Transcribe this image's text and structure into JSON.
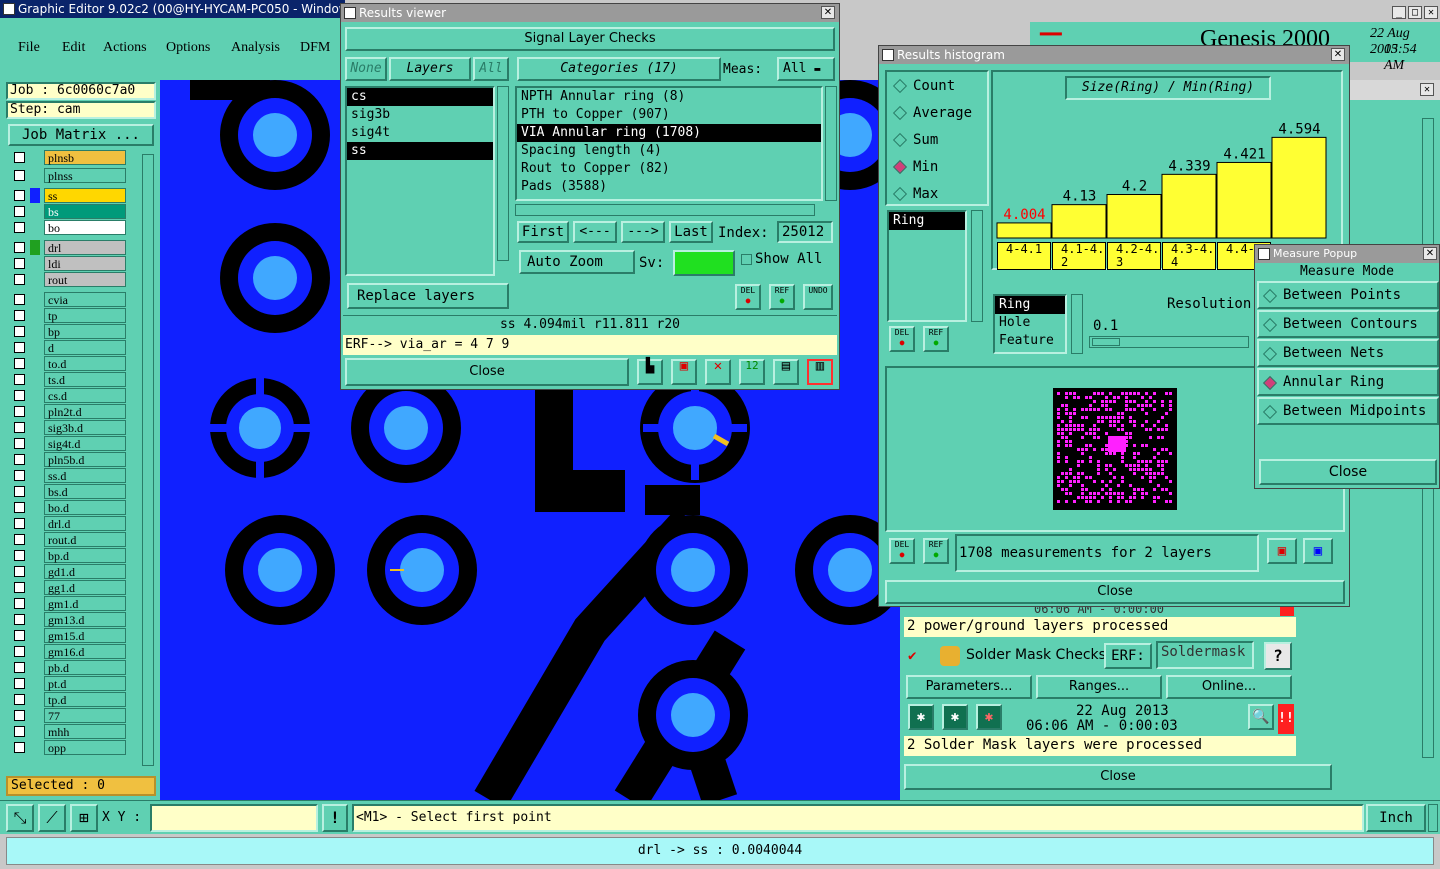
{
  "main_window": {
    "title": "Graphic Editor 9.02c2 (00@HY-HYCAM-PC050 - Windows,"
  },
  "menu": [
    "File",
    "Edit",
    "Actions",
    "Options",
    "Analysis",
    "DFM"
  ],
  "job": {
    "job_label": "Job : 6c0060c7a0",
    "step_label": "Step: cam",
    "matrix_button": "Job Matrix ..."
  },
  "layers": [
    {
      "name": "plnsb",
      "color": "#f0c040"
    },
    {
      "name": "plnss",
      "color": "#5fd0b2"
    },
    {
      "name": "ss",
      "color": "#ffd700",
      "swatch": "#1020ff"
    },
    {
      "name": "bs",
      "color": "#009a7a"
    },
    {
      "name": "bo",
      "color": "#ffffff"
    },
    {
      "name": "drl",
      "color": "#c0c0c0",
      "swatch": "#20a020"
    },
    {
      "name": "ldi",
      "color": "#c0c0c0"
    },
    {
      "name": "rout",
      "color": "#c0c0c0"
    },
    {
      "name": "cvia"
    },
    {
      "name": "tp"
    },
    {
      "name": "bp"
    },
    {
      "name": "d"
    },
    {
      "name": "to.d"
    },
    {
      "name": "ts.d"
    },
    {
      "name": "cs.d"
    },
    {
      "name": "pln2t.d"
    },
    {
      "name": "sig3b.d"
    },
    {
      "name": "sig4t.d"
    },
    {
      "name": "pln5b.d"
    },
    {
      "name": "ss.d"
    },
    {
      "name": "bs.d"
    },
    {
      "name": "bo.d"
    },
    {
      "name": "drl.d"
    },
    {
      "name": "rout.d"
    },
    {
      "name": "bp.d"
    },
    {
      "name": "gd1.d"
    },
    {
      "name": "gg1.d"
    },
    {
      "name": "gm1.d"
    },
    {
      "name": "gm13.d"
    },
    {
      "name": "gm15.d"
    },
    {
      "name": "gm16.d"
    },
    {
      "name": "pb.d"
    },
    {
      "name": "pt.d"
    },
    {
      "name": "tp.d"
    },
    {
      "name": "77"
    },
    {
      "name": "mhh"
    },
    {
      "name": "opp"
    }
  ],
  "selected_label": "Selected : 0",
  "results_viewer": {
    "title": "Results viewer",
    "header": "Signal Layer Checks",
    "none_btn": "None",
    "layers_btn": "Layers",
    "all_btn": "All",
    "categories_btn": "Categories (17)",
    "meas_label": "Meas:",
    "meas_value": "All",
    "layer_list": [
      "cs",
      "sig3b",
      "sig4t",
      "ss"
    ],
    "category_list": [
      "NPTH Annular ring (8)",
      "PTH to Copper (907)",
      "VIA Annular ring (1708)",
      "Spacing length (4)",
      "Rout to Copper (82)",
      "Pads (3588)"
    ],
    "first": "First",
    "prev": "<---",
    "next": "--->",
    "last": "Last",
    "index_label": "Index:",
    "index_value": "25012",
    "auto_zoom": "Auto Zoom",
    "sv_label": "Sv:",
    "show_all": "Show All",
    "replace_layers": "Replace layers",
    "del": "DEL",
    "ref": "REF",
    "undo": "UNDO",
    "measure_info": "ss 4.094mil   r11.811   r20",
    "erf_line": "ERF--> via_ar = 4 7 9",
    "close": "Close"
  },
  "histogram": {
    "title": "Results histogram",
    "modes": [
      "Count",
      "Average",
      "Sum",
      "Min",
      "Max"
    ],
    "selected_mode": "Min",
    "chart_title": "Size(Ring) / Min(Ring)",
    "ring_list": [
      "Ring"
    ],
    "list2": [
      "Ring",
      "Hole",
      "Feature"
    ],
    "resolution_label": "Resolution",
    "resolution_value": "0.1",
    "summary": "1708 measurements for 2 layers",
    "close": "Close",
    "del": "DEL",
    "ref": "REF"
  },
  "chart_data": {
    "type": "bar",
    "title": "Size(Ring) / Min(Ring)",
    "categories": [
      "4-4.1",
      "4.1-4.2",
      "4.2-4.3",
      "4.3-4.4",
      "4.4-4."
    ],
    "values": [
      4.004,
      4.13,
      4.2,
      4.339,
      4.421,
      4.594
    ],
    "value_labels": [
      "4.004",
      "4.13",
      "4.2",
      "4.339",
      "4.421",
      "4.594"
    ],
    "bar_color": "#ffff33",
    "highlight_color": "#ff0000"
  },
  "measure_popup": {
    "title": "Measure Popup",
    "header": "Measure Mode",
    "modes": [
      "Between Points",
      "Between Contours",
      "Between Nets",
      "Annular Ring",
      "Between Midpoints"
    ],
    "selected": "Annular Ring",
    "close": "Close"
  },
  "genesis": {
    "brand": "Genesis 2000",
    "date": "22 Aug 2013",
    "time": "05:54 AM"
  },
  "checklist": {
    "time_row1": "06:06 AM - 0:00:00",
    "processed1": "2 power/ground layers processed",
    "solder_title": "Solder Mask Checks",
    "erf_label": "ERF:",
    "erf_value": "Soldermask",
    "parameters": "Parameters...",
    "ranges": "Ranges...",
    "online": "Online...",
    "date": "22 Aug 2013",
    "time": "06:06 AM - 0:00:03",
    "processed2": "2 Solder Mask layers were processed",
    "close": "Close"
  },
  "bottom": {
    "xy_label": "X Y :",
    "prompt": "<M1> - Select first point",
    "units": "Inch",
    "status": "drl -> ss : 0.0040044"
  }
}
